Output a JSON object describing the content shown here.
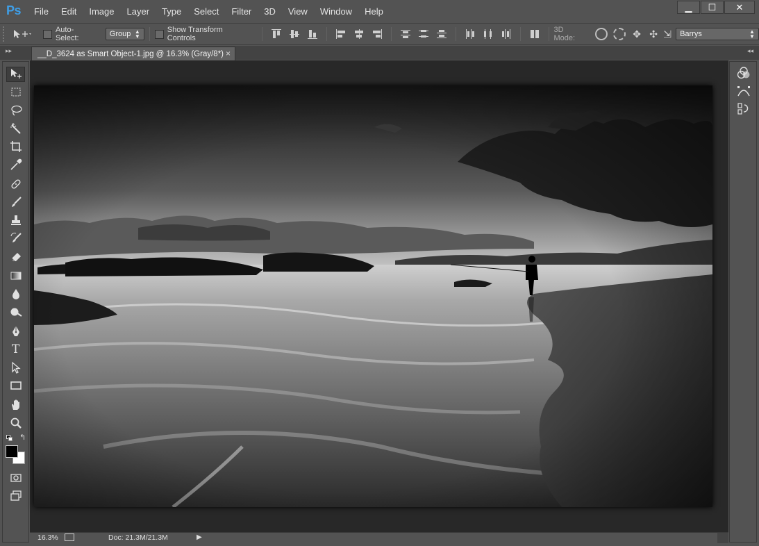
{
  "app": {
    "logo": "Ps",
    "menu": [
      "File",
      "Edit",
      "Image",
      "Layer",
      "Type",
      "Select",
      "Filter",
      "3D",
      "View",
      "Window",
      "Help"
    ],
    "window_controls": {
      "minimize": "▁",
      "maximize": "☐",
      "close": "✕"
    }
  },
  "options_bar": {
    "move_tool_icon": "move-icon",
    "auto_select_label": "Auto-Select:",
    "auto_select_checked": false,
    "auto_select_target": "Group",
    "show_transform_label": "Show Transform Controls",
    "show_transform_checked": false,
    "mode_3d_label": "3D Mode:",
    "workspace": "Barrys"
  },
  "document": {
    "tab_title": "__D_3624 as Smart Object-1.jpg @ 16.3% (Gray/8*)",
    "tab_close": "×",
    "image_description_icon": "photo-canvas"
  },
  "statusbar": {
    "zoom": "16.3%",
    "doc_info": "Doc: 21.3M/21.3M",
    "arrow": "▶"
  },
  "toolbox": {
    "tools": [
      "move-tool",
      "marquee-tool",
      "lasso-tool",
      "magic-wand-tool",
      "crop-tool",
      "eyedropper-tool",
      "healing-brush-tool",
      "brush-tool",
      "clone-stamp-tool",
      "history-brush-tool",
      "eraser-tool",
      "gradient-tool",
      "blur-tool",
      "dodge-tool",
      "pen-tool",
      "type-tool",
      "path-selection-tool",
      "rectangle-tool",
      "hand-tool",
      "zoom-tool"
    ],
    "type_glyph": "T",
    "foreground_color": "#000000",
    "background_color": "#ffffff"
  },
  "colors": {
    "ui_bg": "#535353",
    "canvas_bg": "#282828",
    "logo_blue": "#3f9ee6"
  }
}
